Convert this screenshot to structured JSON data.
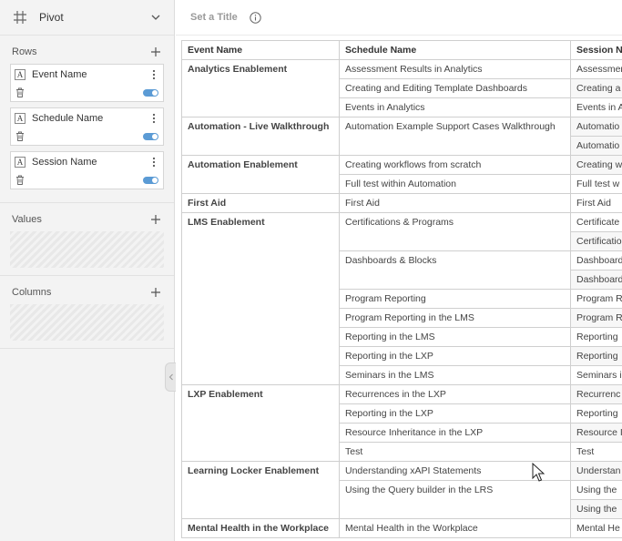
{
  "sidebar": {
    "title": "Pivot",
    "rows": {
      "label": "Rows",
      "fields": [
        {
          "name": "Event Name",
          "type": "A"
        },
        {
          "name": "Schedule Name",
          "type": "A"
        },
        {
          "name": "Session Name",
          "type": "A"
        }
      ]
    },
    "values": {
      "label": "Values"
    },
    "columns": {
      "label": "Columns"
    }
  },
  "main": {
    "title_placeholder": "Set a Title",
    "table": {
      "headers": [
        "Event Name",
        "Schedule Name",
        "Session N"
      ],
      "rows": [
        {
          "event": "Analytics Enablement",
          "schedule": "Assessment Results in Analytics",
          "session": "Assessmen"
        },
        {
          "event": "",
          "schedule": "Creating and Editing Template Dashboards",
          "session": "Creating a"
        },
        {
          "event": "",
          "schedule": "Events in Analytics",
          "session": "Events in A"
        },
        {
          "event": "Automation - Live Walkthrough",
          "schedule": "Automation Example Support Cases Walkthrough",
          "session": "Automatio"
        },
        {
          "event": "",
          "schedule": "",
          "session": "Automatio"
        },
        {
          "event": "Automation Enablement",
          "schedule": "Creating workflows from scratch",
          "session": "Creating w"
        },
        {
          "event": "",
          "schedule": "Full test within Automation",
          "session": "Full test w"
        },
        {
          "event": "First Aid",
          "schedule": "First Aid",
          "session": "First Aid"
        },
        {
          "event": "LMS Enablement",
          "schedule": "Certifications & Programs",
          "session": "Certificate"
        },
        {
          "event": "",
          "schedule": "",
          "session": "Certificatio"
        },
        {
          "event": "",
          "schedule": "Dashboards & Blocks",
          "session": "Dashboard"
        },
        {
          "event": "",
          "schedule": "",
          "session": "Dashboard"
        },
        {
          "event": "",
          "schedule": "Program Reporting",
          "session": "Program R"
        },
        {
          "event": "",
          "schedule": "Program Reporting in the LMS",
          "session": "Program R"
        },
        {
          "event": "",
          "schedule": "Reporting in the LMS",
          "session": "Reporting"
        },
        {
          "event": "",
          "schedule": "Reporting in the LXP",
          "session": "Reporting"
        },
        {
          "event": "",
          "schedule": "Seminars in the LMS",
          "session": "Seminars i"
        },
        {
          "event": "LXP Enablement",
          "schedule": "Recurrences in the LXP",
          "session": "Recurrenc"
        },
        {
          "event": "",
          "schedule": "Reporting in the LXP",
          "session": "Reporting"
        },
        {
          "event": "",
          "schedule": "Resource Inheritance in the LXP",
          "session": "Resource I"
        },
        {
          "event": "",
          "schedule": "Test",
          "session": "Test"
        },
        {
          "event": "Learning Locker Enablement",
          "schedule": "Understanding xAPI Statements",
          "session": "Understan"
        },
        {
          "event": "",
          "schedule": "Using the Query builder in the LRS",
          "session": "Using the"
        },
        {
          "event": "",
          "schedule": "",
          "session": "Using the"
        },
        {
          "event": "Mental Health in the Workplace",
          "schedule": "Mental Health in the Workplace",
          "session": "Mental He"
        }
      ]
    }
  }
}
